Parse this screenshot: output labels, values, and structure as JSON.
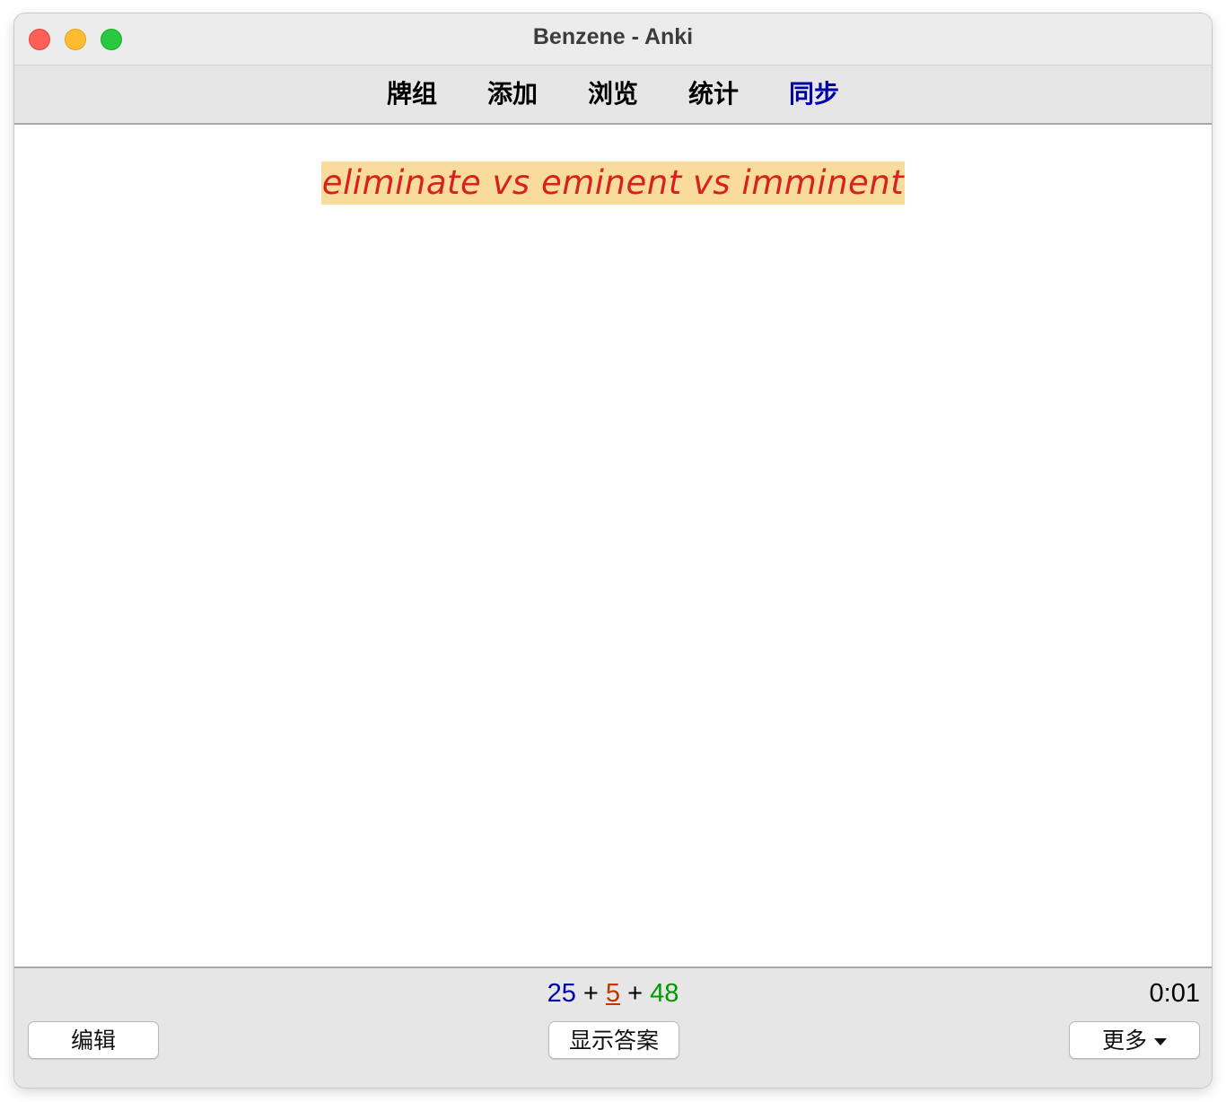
{
  "window": {
    "title": "Benzene - Anki"
  },
  "toolbar": {
    "items": [
      {
        "label": "牌组"
      },
      {
        "label": "添加"
      },
      {
        "label": "浏览"
      },
      {
        "label": "统计"
      },
      {
        "label": "同步"
      }
    ]
  },
  "card": {
    "front": "eliminate vs eminent vs imminent",
    "text_color": "#d8201e",
    "highlight_color": "#f9dc9c"
  },
  "bottom": {
    "counts": {
      "new": "25",
      "learn": "5",
      "review": "48",
      "sep": "+"
    },
    "timer": "0:01",
    "edit_label": "编辑",
    "show_answer_label": "显示答案",
    "more_label": "更多",
    "more_icon": "caret-down-icon"
  },
  "colors": {
    "new": "#0000a8",
    "learn": "#c33500",
    "review": "#009900",
    "sync": "#0000aa",
    "close": "#fe5f57",
    "minimize": "#febc2e",
    "maximize": "#28c840"
  }
}
